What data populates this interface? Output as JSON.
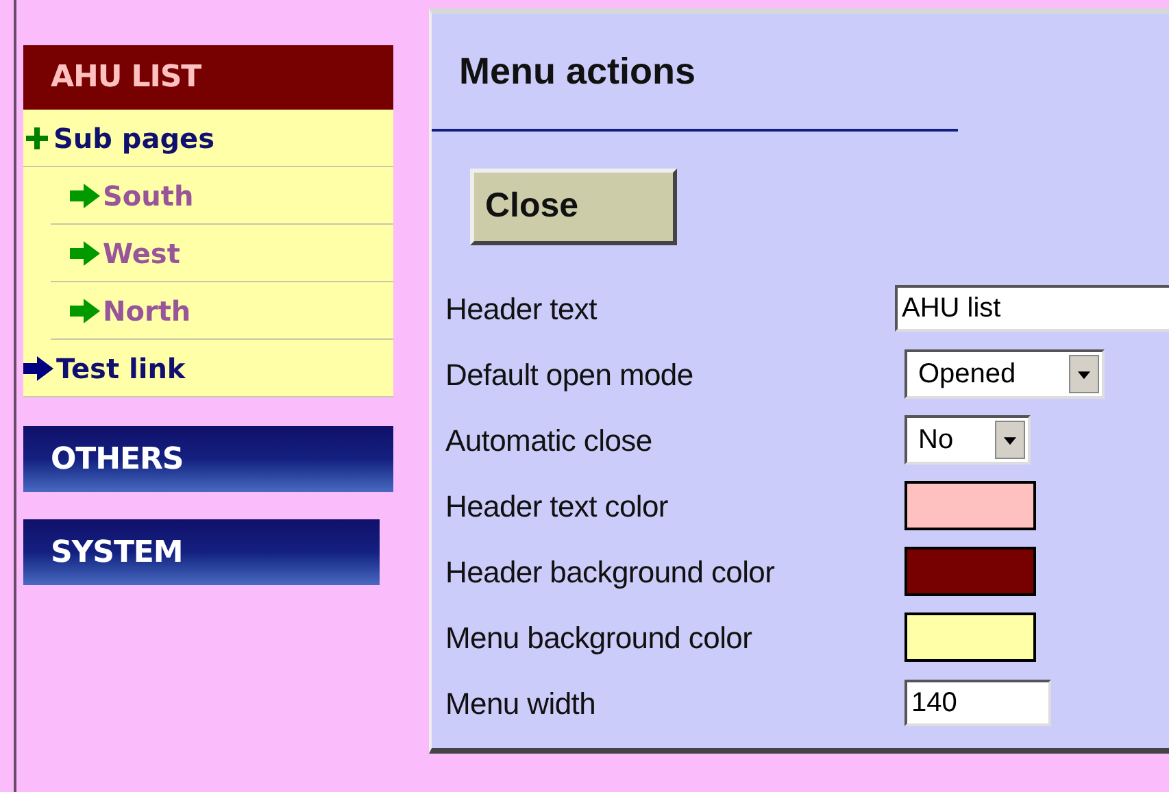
{
  "sidebar": {
    "sections": [
      {
        "title": "AHU LIST",
        "expanded": true,
        "items": [
          {
            "label": "Sub pages",
            "kind": "group",
            "children": [
              {
                "label": "South"
              },
              {
                "label": "West"
              },
              {
                "label": "North"
              }
            ]
          },
          {
            "label": "Test link",
            "kind": "link"
          }
        ]
      },
      {
        "title": "OTHERS",
        "expanded": false
      },
      {
        "title": "SYSTEM",
        "expanded": false
      }
    ]
  },
  "panel": {
    "title": "Menu actions",
    "button": "Close",
    "fields": [
      {
        "label": "Header text",
        "kind": "text",
        "value": "AHU list"
      },
      {
        "label": "Default open mode",
        "kind": "select",
        "value": "Opened"
      },
      {
        "label": "Automatic close",
        "kind": "select",
        "value": "No"
      },
      {
        "label": "Header text color",
        "kind": "color",
        "color": "#ffc0c0"
      },
      {
        "label": "Header background color",
        "kind": "color",
        "color": "#770000"
      },
      {
        "label": "Menu background color",
        "kind": "color",
        "color": "#ffffa8"
      },
      {
        "label": "Menu width",
        "kind": "text",
        "value": "140"
      }
    ]
  }
}
